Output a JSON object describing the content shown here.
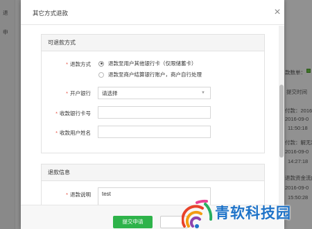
{
  "background": {
    "left_fragments": [
      "退",
      "申"
    ],
    "right_fragments": [
      "款数单：",
      "提交时间",
      "付款：2016-0",
      "2016-09-0",
      "11:50:18",
      "付款：解无款",
      "2016-09-0",
      "14:27:18",
      "退款资金流向",
      "2016-09-0",
      "15:50:28"
    ]
  },
  "modal": {
    "title": "其它方式退款",
    "close_icon": "close-icon"
  },
  "refund_method_panel": {
    "heading": "可退款方式",
    "label": "退款方式",
    "options": [
      {
        "label": "退款至用户其他银行卡（仅限储蓄卡）",
        "checked": true
      },
      {
        "label": "退款至商户结算银行账户，商户自行处理",
        "checked": false
      }
    ],
    "bank_label": "开户银行",
    "bank_value": "请选择",
    "card_label": "收款银行卡号",
    "card_value": "",
    "name_label": "收款用户姓名",
    "name_value": ""
  },
  "refund_info_panel": {
    "heading": "退款信息",
    "reason_label": "退款说明",
    "reason_value": "test"
  },
  "footer": {
    "submit_label": "提交申请",
    "cancel_label": ""
  },
  "colors": {
    "accent_green": "#2eb34a",
    "required_red": "#e74c3c",
    "watermark_blue": "#1f73c8"
  },
  "watermark": {
    "text": "青软科技园"
  }
}
